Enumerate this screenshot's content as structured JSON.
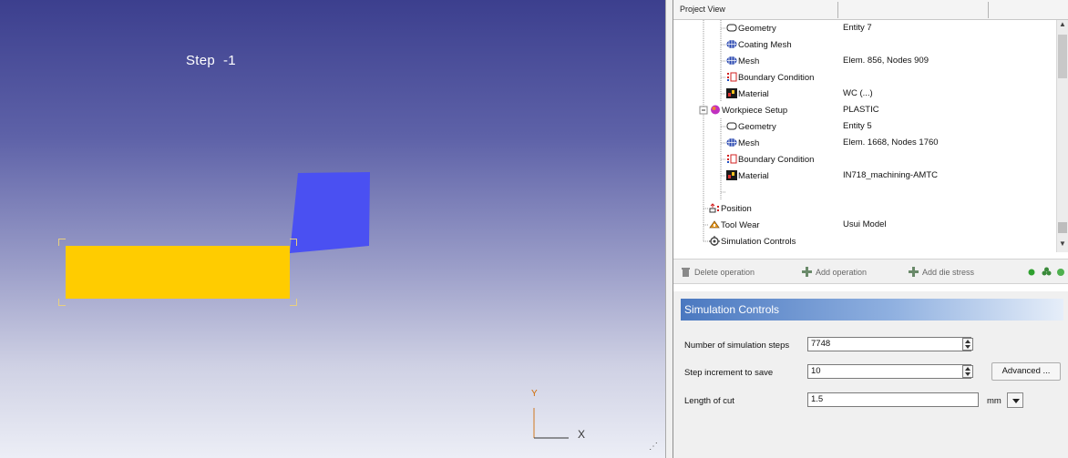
{
  "viewport": {
    "step_label": "Step  -1",
    "axis_y_label": "Y",
    "axis_x_label": "X",
    "workpiece_color": "#ffcc00",
    "tool_color": "#4a50f2"
  },
  "project_view": {
    "title": "Project View",
    "tree": [
      {
        "name": "Geometry",
        "value": "Entity 7",
        "icon": "geometry-icon"
      },
      {
        "name": "Coating Mesh",
        "value": "",
        "icon": "mesh-icon"
      },
      {
        "name": "Mesh",
        "value": "Elem. 856, Nodes 909",
        "icon": "mesh-icon"
      },
      {
        "name": "Boundary Condition",
        "value": "",
        "icon": "boundary-condition-icon"
      },
      {
        "name": "Material",
        "value": "WC (...)",
        "icon": "material-icon"
      },
      {
        "name": "Workpiece Setup",
        "value": "PLASTIC",
        "icon": "workpiece-icon"
      },
      {
        "name": "Geometry",
        "value": "Entity 5",
        "icon": "geometry-icon"
      },
      {
        "name": "Mesh",
        "value": "Elem. 1668, Nodes 1760",
        "icon": "mesh-icon"
      },
      {
        "name": "Boundary Condition",
        "value": "",
        "icon": "boundary-condition-icon"
      },
      {
        "name": "Material",
        "value": "IN718_machining-AMTC",
        "icon": "material-icon"
      },
      {
        "name": "Position",
        "value": "",
        "icon": "position-icon"
      },
      {
        "name": "Tool Wear",
        "value": "Usui Model",
        "icon": "tool-wear-icon"
      },
      {
        "name": "Simulation Controls",
        "value": "",
        "icon": "simulation-controls-icon"
      }
    ]
  },
  "toolbar": {
    "delete_operation": "Delete operation",
    "add_operation": "Add operation",
    "add_die_stress": "Add die stress"
  },
  "simulation_controls": {
    "title": "Simulation Controls",
    "number_of_steps_label": "Number of simulation steps",
    "number_of_steps_value": "7748",
    "step_increment_label": "Step increment to save",
    "step_increment_value": "10",
    "advanced_label": "Advanced ...",
    "length_of_cut_label": "Length of cut",
    "length_of_cut_value": "1.5",
    "length_unit": "mm"
  }
}
